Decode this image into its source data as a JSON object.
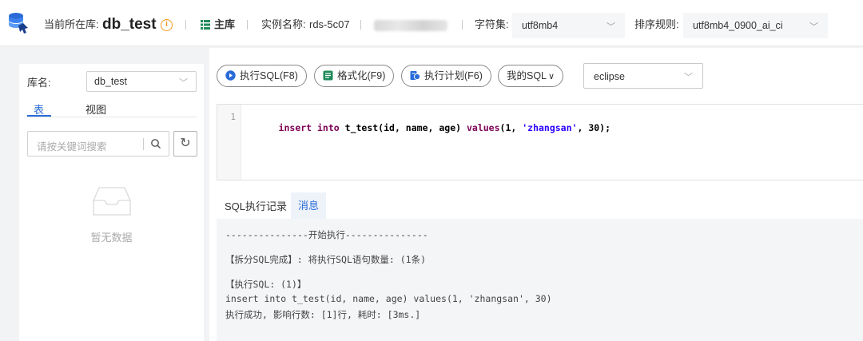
{
  "header": {
    "current_db_label": "当前所在库:",
    "current_db": "db_test",
    "role": "主库",
    "instance_label": "实例名称:",
    "instance_name": "rds-5c07",
    "charset_label": "字符集:",
    "charset_value": "utf8mb4",
    "collation_label": "排序规则:",
    "collation_value": "utf8mb4_0900_ai_ci"
  },
  "sidebar": {
    "db_label": "库名:",
    "db_value": "db_test",
    "tabs": [
      "表",
      "视图"
    ],
    "search_placeholder": "请按关键词搜索",
    "empty_text": "暂无数据"
  },
  "toolbar": {
    "execute": "执行SQL(F8)",
    "format": "格式化(F9)",
    "plan": "执行计划(F6)",
    "my_sql": "我的SQL",
    "theme": "eclipse"
  },
  "editor": {
    "line_number": "1",
    "tokens": [
      {
        "t": "insert into",
        "k": "kw"
      },
      {
        "t": " t_test(id, name, age) ",
        "k": "tx"
      },
      {
        "t": "values",
        "k": "kw"
      },
      {
        "t": "(1, ",
        "k": "tx"
      },
      {
        "t": "'zhangsan'",
        "k": "str"
      },
      {
        "t": ", 30);",
        "k": "tx"
      }
    ]
  },
  "results": {
    "tabs": [
      "SQL执行记录",
      "消息"
    ],
    "active_tab": "消息",
    "lines": [
      "---------------开始执行---------------",
      "【拆分SQL完成】: 将执行SQL语句数量: (1条)",
      "【执行SQL: (1)】",
      "insert into t_test(id, name, age) values(1, 'zhangsan', 30)",
      "执行成功, 影响行数: [1]行, 耗时: [3ms.]"
    ]
  },
  "colors": {
    "accent": "#2a6bd8",
    "warning": "#f59a23",
    "keyword": "#7f0055",
    "string": "#2a00ff"
  }
}
